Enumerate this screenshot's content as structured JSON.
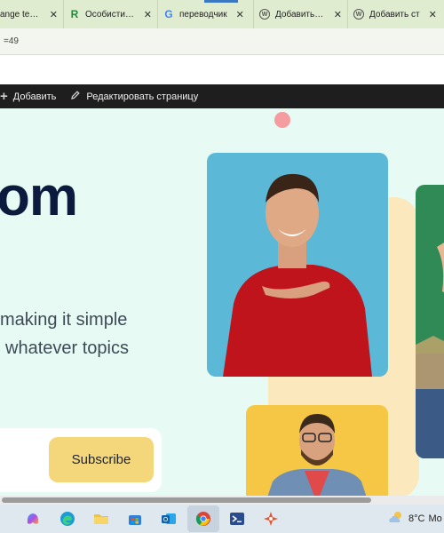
{
  "browser": {
    "tabs": [
      {
        "title": "ange temp",
        "favicon": "page-icon"
      },
      {
        "title": "Особистий к",
        "favicon": "r-icon"
      },
      {
        "title": "переводчик",
        "favicon": "google-icon"
      },
      {
        "title": "Добавить ст",
        "favicon": "wordpress-icon"
      },
      {
        "title": "Добавить ст",
        "favicon": "wordpress-icon"
      }
    ],
    "address_text": "=49"
  },
  "adminbar": {
    "add_label": "Добавить",
    "edit_label": "Редактировать страницу"
  },
  "hero": {
    "title": "om",
    "lines": [
      "making it simple",
      "whatever topics"
    ],
    "subscribe_label": "Subscribe"
  },
  "taskbar": {
    "apps": [
      "copilot-icon",
      "edge-icon",
      "file-explorer-icon",
      "store-icon",
      "outlook-icon",
      "chrome-icon",
      "powershell-icon",
      "app-icon"
    ],
    "weather_temp": "8°C",
    "weather_text": "Mo"
  },
  "colors": {
    "tabstrip": "#dfeccf",
    "adminbar": "#1e1e1e",
    "page_bg": "#e7fbf4",
    "title": "#0c1b3d",
    "button": "#f5d77b"
  }
}
